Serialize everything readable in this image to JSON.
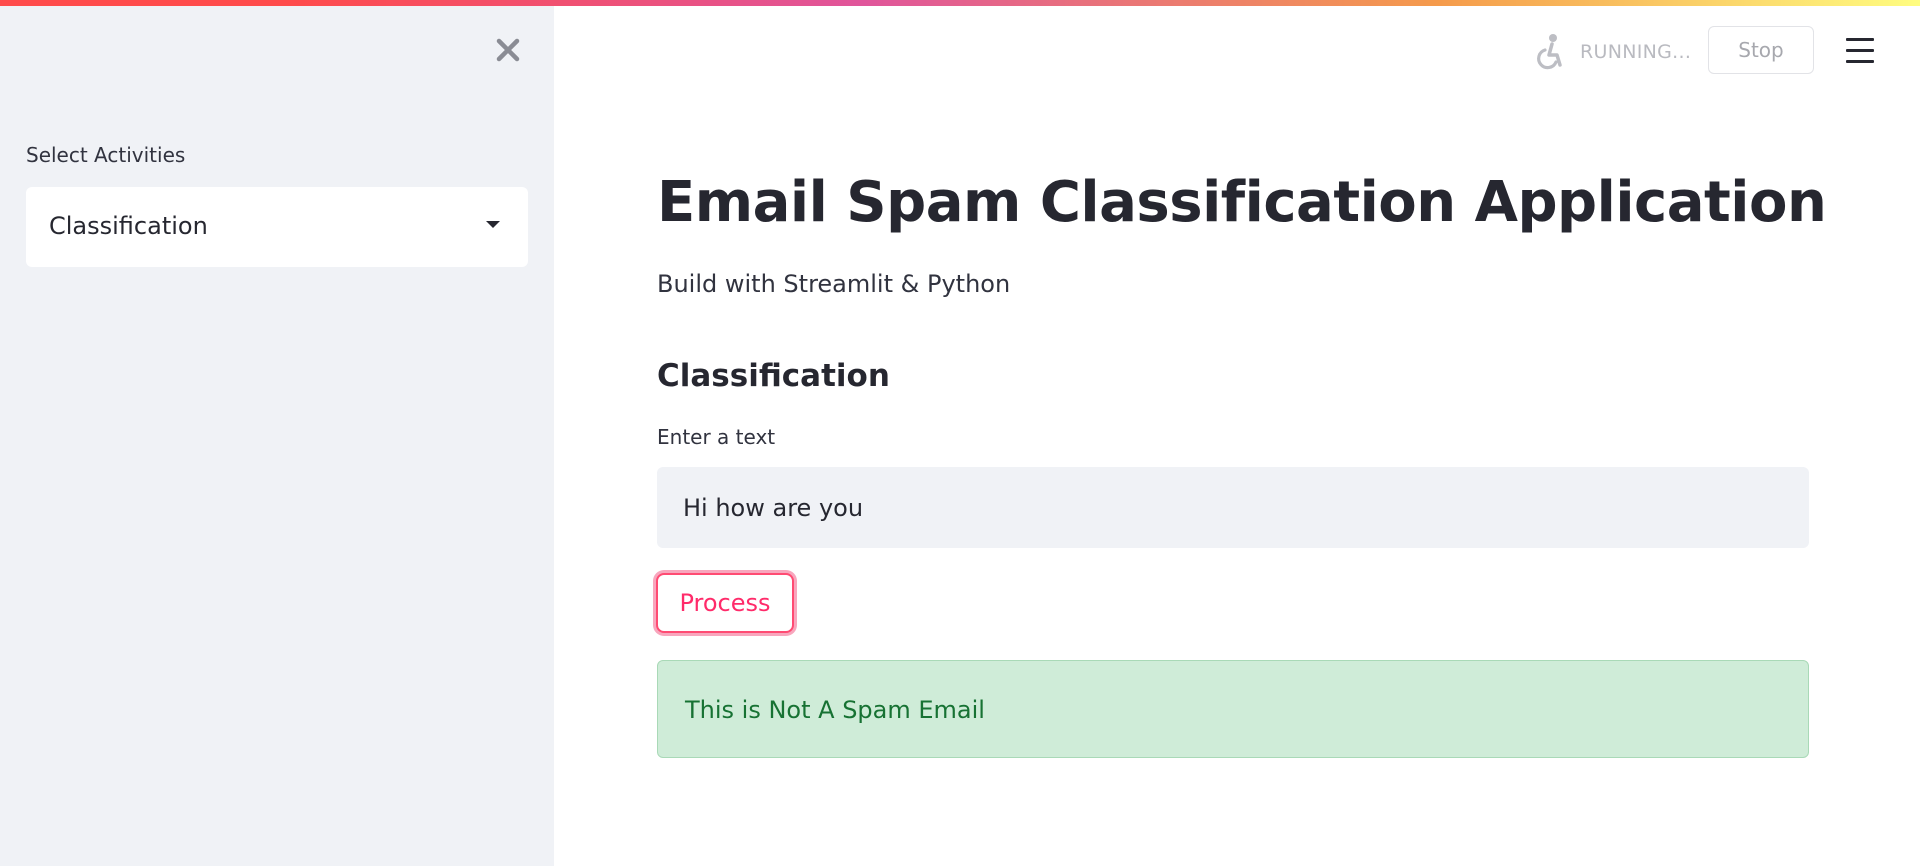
{
  "colors": {
    "accent": "#ff4b4b",
    "process_button_text": "#ff2b6a",
    "sidebar_background": "#f0f2f6",
    "success_background": "#cfecd8",
    "success_text": "#177233"
  },
  "sidebar": {
    "close_icon": "close-icon",
    "select_label": "Select Activities",
    "select_value": "Classification"
  },
  "toolbar": {
    "status_icon": "running-man-icon",
    "status_text": "RUNNING...",
    "stop_label": "Stop",
    "menu_icon": "hamburger-menu-icon"
  },
  "main": {
    "title": "Email Spam Classification Application",
    "subtitle": "Build with Streamlit & Python",
    "section_heading": "Classification",
    "input_label": "Enter a text",
    "input_value": "Hi how are you",
    "process_label": "Process",
    "result_message": "This is Not A Spam Email"
  }
}
